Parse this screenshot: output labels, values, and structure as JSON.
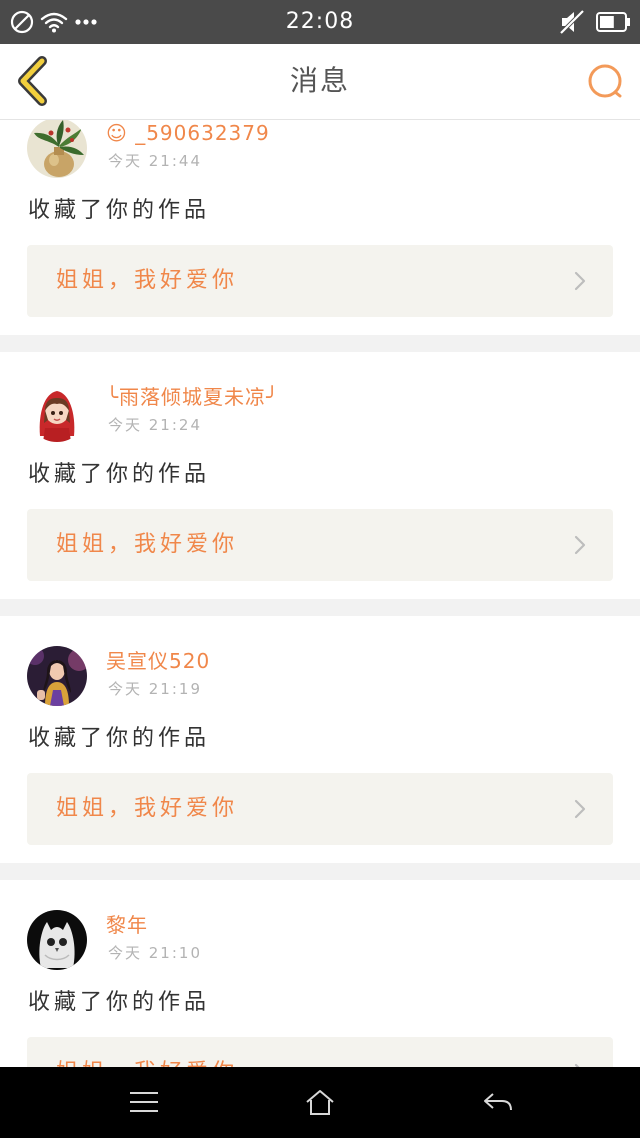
{
  "status_bar": {
    "time": "22:08",
    "battery_level": 0.6,
    "icons": [
      "do-not-disturb-icon",
      "wifi-icon",
      "more-dots-icon",
      "mute-icon",
      "battery-icon"
    ]
  },
  "header": {
    "title": "消息",
    "back_icon": "back-chevron-icon",
    "search_icon": "search-icon"
  },
  "messages": [
    {
      "avatar": "potted-plant-avatar",
      "username": "☺ _590632379",
      "time": "今天 21:44",
      "action": "收藏了你的作品",
      "work_title": "姐姐，我好爱你"
    },
    {
      "avatar": "red-hood-girl-avatar",
      "username": "╰雨落倾城夏未凉╯",
      "time": "今天 21:24",
      "action": "收藏了你的作品",
      "work_title": "姐姐，我好爱你"
    },
    {
      "avatar": "woman-photo-avatar",
      "username": "吴宣仪520",
      "time": "今天 21:19",
      "action": "收藏了你的作品",
      "work_title": "姐姐，我好爱你"
    },
    {
      "avatar": "white-owl-avatar",
      "username": "黎年",
      "time": "今天 21:10",
      "action": "收藏了你的作品",
      "work_title": "姐姐，我好爱你"
    }
  ],
  "nav_bar": {
    "icons": [
      "menu-icon",
      "home-icon",
      "back-arrow-icon"
    ]
  },
  "colors": {
    "status_bar_bg": "#4a4a4a",
    "accent": "#f0874a",
    "work_box_bg": "#f4f3ee",
    "separator": "#f2f2f2",
    "nav_bar_bg": "#000000",
    "back_chevron": "#f2cf3d",
    "search_icon": "#f39a59"
  }
}
